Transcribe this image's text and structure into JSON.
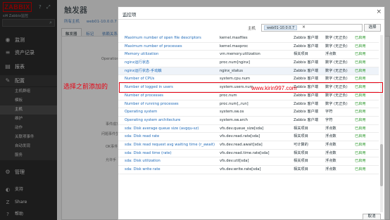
{
  "sidebar": {
    "logo": "ZABBIX",
    "subtitle": "sl4 Zabbix监控",
    "icons": [
      "?",
      "⤢"
    ],
    "search_icon": "search-icon",
    "nav": [
      {
        "label": "监测",
        "icon": "eye-icon",
        "glyph": "◉"
      },
      {
        "label": "资产记录",
        "icon": "list-icon",
        "glyph": "≡"
      },
      {
        "label": "报表",
        "icon": "chart-icon",
        "glyph": "▤"
      },
      {
        "label": "配置",
        "icon": "wrench-icon",
        "glyph": "✎"
      }
    ],
    "sub_items": [
      "主机群组",
      "模板",
      "主机",
      "维护",
      "动作",
      "关联项事件",
      "自动发现",
      "服务"
    ],
    "admin": {
      "label": "管理",
      "glyph": "⚙"
    },
    "bottom": [
      {
        "label": "支持",
        "glyph": "◐"
      },
      {
        "label": "Share",
        "glyph": "Z"
      },
      {
        "label": "帮助",
        "glyph": "?"
      }
    ]
  },
  "main": {
    "title": "触发器",
    "crumbs": [
      "所有主机",
      "web01-10.0.0.7"
    ],
    "tabs": [
      "触发器",
      "标记",
      "依赖关系"
    ],
    "bg_labels": [
      "Operational",
      "事件成功",
      "问题事件生成",
      "OK事件关",
      "允许手"
    ]
  },
  "modal": {
    "title": "监控项",
    "close": "×",
    "filter_label": "主机",
    "chip": "web01-10.0.0.7",
    "chip_x": "×",
    "select_btn": "选择",
    "cancel_btn": "取消",
    "rows": [
      {
        "name": "Maximum number of open file descriptors",
        "key": "kernel.maxfiles",
        "type": "Zabbix 客户端",
        "value": "数字 (无正负)",
        "status": "已启用"
      },
      {
        "name": "Maximum number of processes",
        "key": "kernel.maxproc",
        "type": "Zabbix 客户端",
        "value": "数字 (无正负)",
        "status": "已启用"
      },
      {
        "name": "Memory utilization",
        "key": "vm.memory.utilization",
        "type": "相关项目",
        "value": "浮点数",
        "status": "已启用"
      },
      {
        "name": "nginx运行状态",
        "key": "proc.num[nginx]",
        "type": "Zabbix 客户端",
        "value": "数字 (无正负)",
        "status": "已启用"
      },
      {
        "name": "nginx运行状态-手动触",
        "key": "nginx_status",
        "type": "Zabbix 客户端",
        "value": "数字 (无正负)",
        "status": "已启用"
      },
      {
        "name": "Number of CPUs",
        "key": "system.cpu.num",
        "type": "Zabbix 客户端",
        "value": "数字 (无正负)",
        "status": "已启用"
      },
      {
        "name": "Number of logged in users",
        "key": "system.users.num",
        "type": "Zabbix 客户端",
        "value": "数字 (无正负)",
        "status": "已启用"
      },
      {
        "name": "Number of processes",
        "key": "proc.num",
        "type": "Zabbix 客户端",
        "value": "数字 (无正负)",
        "status": "已启用"
      },
      {
        "name": "Number of running processes",
        "key": "proc.num[,,run]",
        "type": "Zabbix 客户端",
        "value": "数字 (无正负)",
        "status": "已启用"
      },
      {
        "name": "Operating system",
        "key": "system.sw.os",
        "type": "Zabbix 客户端",
        "value": "字符",
        "status": "已启用"
      },
      {
        "name": "Operating system architecture",
        "key": "system.sw.arch",
        "type": "Zabbix 客户端",
        "value": "字符",
        "status": "已启用"
      },
      {
        "name": "sda: Disk average queue size (avgqu-sz)",
        "key": "vfs.dev.queue_size[sda]",
        "type": "相关项目",
        "value": "浮点数",
        "status": "已启用"
      },
      {
        "name": "sda: Disk read rate",
        "key": "vfs.dev.read.rate[sda]",
        "type": "相关项目",
        "value": "浮点数",
        "status": "已启用"
      },
      {
        "name": "sda: Disk read request avg waiting time (r_await)",
        "key": "vfs.dev.read.await[sda]",
        "type": "可计算的",
        "value": "浮点数",
        "status": "已启用"
      },
      {
        "name": "sda: Disk read time (rate)",
        "key": "vfs.dev.read.time.rate[sda]",
        "type": "相关项目",
        "value": "浮点数",
        "status": "已启用"
      },
      {
        "name": "sda: Disk utilization",
        "key": "vfs.dev.util[sda]",
        "type": "相关项目",
        "value": "浮点数",
        "status": "已启用"
      },
      {
        "name": "sda: Disk write rate",
        "key": "vfs.dev.write.rate[sda]",
        "type": "相关项目",
        "value": "浮点数",
        "status": "已启用"
      }
    ],
    "highlight_index": 4
  },
  "annotation": {
    "text": "选择之前添加的",
    "watermark": "www.kirin997.com",
    "color": "#e60012"
  }
}
